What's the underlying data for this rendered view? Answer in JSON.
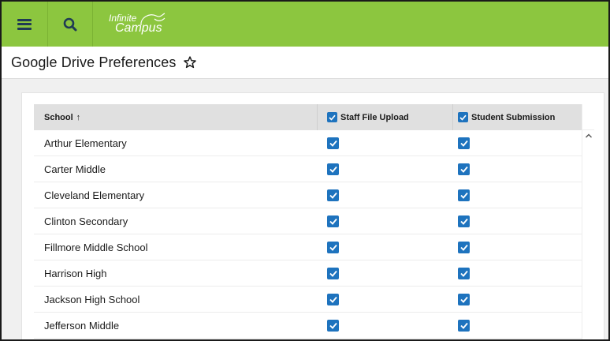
{
  "app": {
    "logo_line1": "Infinite",
    "logo_line2": "Campus",
    "menu_icon": "hamburger-menu-icon",
    "search_icon": "search-icon"
  },
  "colors": {
    "topbar": "#8cc63f",
    "icon": "#1f3a55",
    "checkbox": "#1e73be",
    "header_row": "#e0e0e0"
  },
  "page": {
    "title": "Google Drive Preferences",
    "favorite_icon": "star-outline-icon"
  },
  "table": {
    "columns": {
      "school": "School",
      "school_sort": "↑",
      "staff": "Staff File Upload",
      "student": "Student Submission"
    },
    "header_checks": {
      "staff": true,
      "student": true
    },
    "rows": [
      {
        "school": "Arthur Elementary",
        "staff": true,
        "student": true
      },
      {
        "school": "Carter Middle",
        "staff": true,
        "student": true
      },
      {
        "school": "Cleveland Elementary",
        "staff": true,
        "student": true
      },
      {
        "school": "Clinton Secondary",
        "staff": true,
        "student": true
      },
      {
        "school": "Fillmore Middle School",
        "staff": true,
        "student": true
      },
      {
        "school": "Harrison High",
        "staff": true,
        "student": true
      },
      {
        "school": "Jackson High School",
        "staff": true,
        "student": true
      },
      {
        "school": "Jefferson Middle",
        "staff": true,
        "student": true
      }
    ]
  }
}
